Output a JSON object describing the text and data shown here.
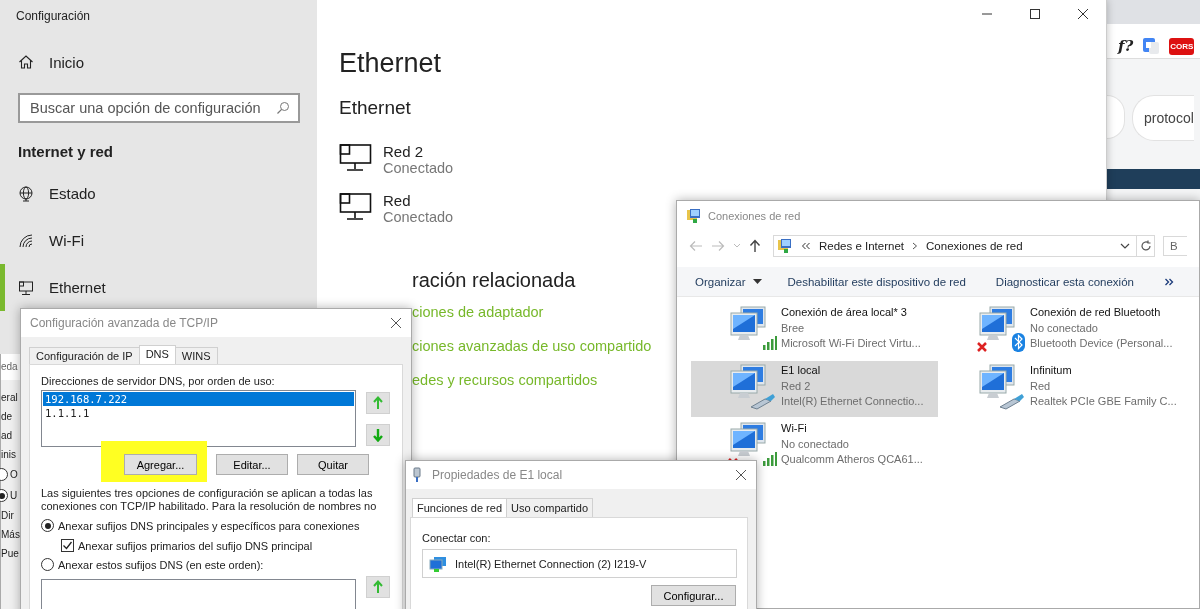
{
  "browser": {
    "function_badge": "f?",
    "extension_badge": "CORS",
    "chips": [
      {
        "label": "protocol"
      }
    ]
  },
  "settings": {
    "title": "Configuración",
    "home": "Inicio",
    "search_placeholder": "Buscar una opción de configuración",
    "section": "Internet y red",
    "nav_items": [
      {
        "label": "Estado",
        "kind": "globe",
        "selected": false
      },
      {
        "label": "Wi-Fi",
        "kind": "wifi",
        "selected": false
      },
      {
        "label": "Ethernet",
        "kind": "ethernet",
        "selected": true
      }
    ],
    "page_title": "Ethernet",
    "subtitle": "Ethernet",
    "networks": [
      {
        "name": "Red  2",
        "status": "Conectado"
      },
      {
        "name": "Red",
        "status": "Conectado"
      }
    ],
    "related_title": "ración relacionada",
    "related_links": [
      "ciones de adaptador",
      "ciones avanzadas de uso compartido",
      "edes y recursos compartidos"
    ]
  },
  "background_dialog": {
    "fragments": [
      {
        "kind": "title",
        "text": "eda"
      },
      {
        "kind": "tab",
        "text": "eral"
      },
      {
        "kind": "text",
        "text": "de"
      },
      {
        "kind": "text",
        "text": "ad"
      },
      {
        "kind": "text",
        "text": "inis"
      },
      {
        "kind": "radio",
        "text": "O",
        "checked": false
      },
      {
        "kind": "radio",
        "text": "U",
        "checked": true
      },
      {
        "kind": "text",
        "text": "Dir"
      },
      {
        "kind": "text",
        "text": "Más"
      },
      {
        "kind": "text",
        "text": "Pue"
      }
    ]
  },
  "tcpip": {
    "title": "Configuración avanzada de TCP/IP",
    "tabs": [
      {
        "label": "Configuración de IP",
        "selected": false
      },
      {
        "label": "DNS",
        "selected": true
      },
      {
        "label": "WINS",
        "selected": false
      }
    ],
    "dns_label": "Direcciones de servidor DNS, por orden de uso:",
    "dns_servers": [
      {
        "address": "192.168.7.222",
        "selected": true
      },
      {
        "address": "1.1.1.1",
        "selected": false
      }
    ],
    "buttons": [
      {
        "label": "Agregar...",
        "highlighted": true
      },
      {
        "label": "Editar...",
        "highlighted": false
      },
      {
        "label": "Quitar",
        "highlighted": false
      }
    ],
    "note": "Las siguientes tres opciones de configuración se aplican a todas las conexiones con TCP/IP habilitado. Para la resolución de nombres no",
    "options": [
      {
        "kind": "radio",
        "label": "Anexar sufijos DNS principales y específicos para conexiones",
        "checked": true
      },
      {
        "kind": "checkbox",
        "label": "Anexar sufijos primarios del sufijo DNS principal",
        "checked": true
      },
      {
        "kind": "radio",
        "label": "Anexar estos sufijos DNS (en este orden):",
        "checked": false
      }
    ]
  },
  "connections": {
    "title": "Conexiones de red",
    "breadcrumb": [
      "Redes e Internet",
      "Conexiones de red"
    ],
    "search_placeholder": "B",
    "toolbar": [
      {
        "label": "Organizar",
        "kind": "menu"
      },
      {
        "label": "Deshabilitar este dispositivo de red",
        "kind": "action"
      },
      {
        "label": "Diagnosticar esta conexión",
        "kind": "action"
      }
    ],
    "items": [
      {
        "name": "Conexión de área local* 3",
        "status": "Bree",
        "device": "Microsoft Wi-Fi Direct Virtu...",
        "kind": "wifi",
        "connected": true,
        "selected": false
      },
      {
        "name": "Conexión de red Bluetooth",
        "status": "No conectado",
        "device": "Bluetooth Device (Personal...",
        "kind": "bluetooth",
        "connected": false,
        "selected": false
      },
      {
        "name": "E1 local",
        "status": "Red  2",
        "device": "Intel(R) Ethernet Connectio...",
        "kind": "ethernet",
        "connected": true,
        "selected": true
      },
      {
        "name": "Infinitum",
        "status": "Red",
        "device": "Realtek PCIe GBE Family C...",
        "kind": "ethernet",
        "connected": true,
        "selected": false
      },
      {
        "name": "Wi-Fi",
        "status": "No conectado",
        "device": "Qualcomm Atheros QCA61...",
        "kind": "wifi",
        "connected": false,
        "selected": false
      }
    ]
  },
  "properties": {
    "title": "Propiedades de E1 local",
    "tabs": [
      {
        "label": "Funciones de red",
        "selected": true
      },
      {
        "label": "Uso compartido",
        "selected": false
      }
    ],
    "connect_label": "Conectar con:",
    "adapter": "Intel(R) Ethernet Connection (2) I219-V",
    "button": "Configurar..."
  }
}
